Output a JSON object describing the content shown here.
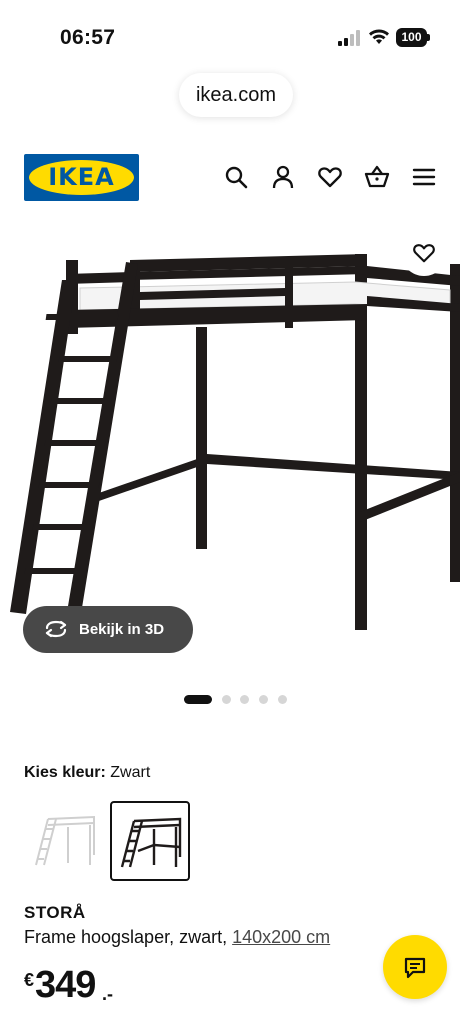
{
  "status_bar": {
    "time": "06:57",
    "battery": "100",
    "signal_icon": "cellular-signal-icon",
    "wifi_icon": "wifi-icon"
  },
  "browser": {
    "url": "ikea.com"
  },
  "header": {
    "logo_text": "IKEA",
    "icons": [
      "search-icon",
      "profile-icon",
      "heart-icon",
      "basket-icon",
      "menu-icon"
    ],
    "brand_blue": "#0058a3",
    "brand_yellow": "#ffdb00"
  },
  "gallery": {
    "view_3d_label": "Bekijk in 3D",
    "image_count": 5,
    "active_image": 1
  },
  "variant": {
    "label": "Kies kleur:",
    "value": "Zwart",
    "swatches": [
      {
        "color": "white",
        "selected": false
      },
      {
        "color": "black",
        "selected": true
      }
    ]
  },
  "product": {
    "name": "STORÅ",
    "description": "Frame hoogslaper, zwart,",
    "size_link": "140x200 cm",
    "price_currency": "€",
    "price_integer": "349",
    "price_decimal": ".-"
  },
  "chat": {
    "icon": "chat-icon"
  }
}
